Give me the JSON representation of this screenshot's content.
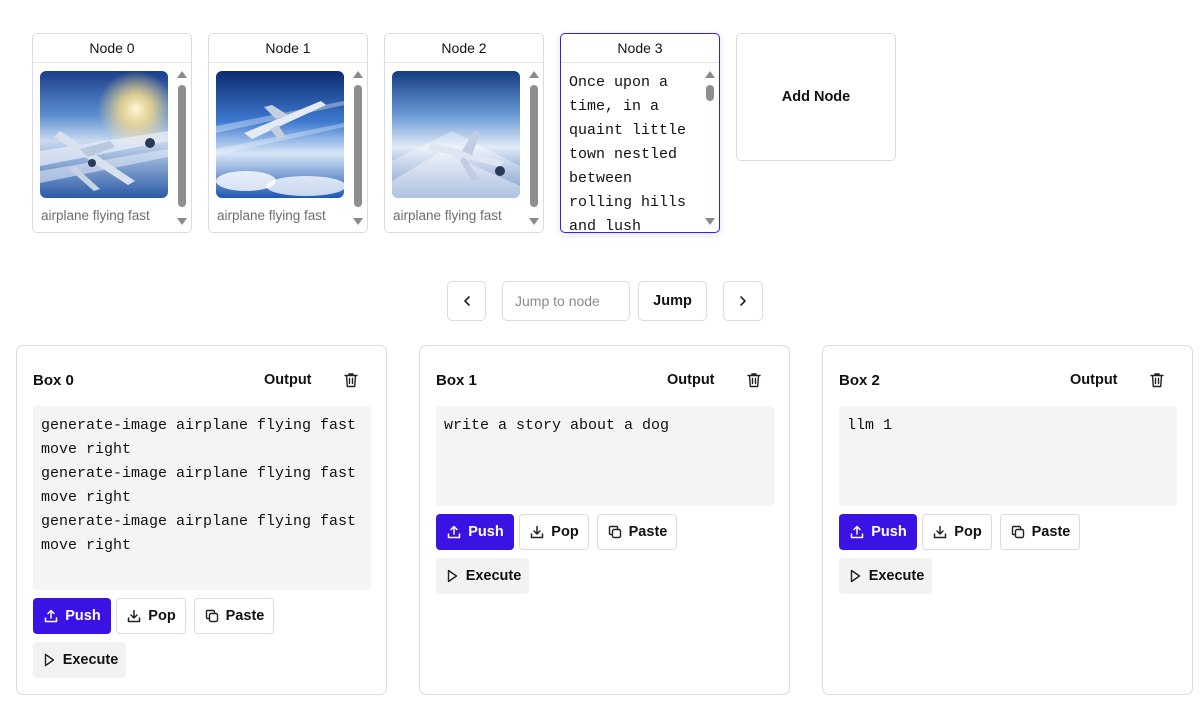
{
  "nodes": [
    {
      "title": "Node 0",
      "caption": "airplane flying fast"
    },
    {
      "title": "Node 1",
      "caption": "airplane flying fast"
    },
    {
      "title": "Node 2",
      "caption": "airplane flying fast"
    },
    {
      "title": "Node 3",
      "text": "Once upon a time, in a quaint little town nestled between rolling hills and lush"
    }
  ],
  "add_node_label": "Add Node",
  "navigation": {
    "jump_placeholder": "Jump to node",
    "jump_label": "Jump"
  },
  "boxes": [
    {
      "title": "Box 0",
      "output_label": "Output",
      "content": "generate-image airplane flying fast\nmove right\ngenerate-image airplane flying fast\nmove right\ngenerate-image airplane flying fast\nmove right",
      "push_label": "Push",
      "pop_label": "Pop",
      "paste_label": "Paste",
      "execute_label": "Execute"
    },
    {
      "title": "Box 1",
      "output_label": "Output",
      "content": "write a story about a dog",
      "push_label": "Push",
      "pop_label": "Pop",
      "paste_label": "Paste",
      "execute_label": "Execute"
    },
    {
      "title": "Box 2",
      "output_label": "Output",
      "content": "llm 1",
      "push_label": "Push",
      "pop_label": "Pop",
      "paste_label": "Paste",
      "execute_label": "Execute"
    }
  ],
  "colors": {
    "accent": "#3b12e4",
    "selected_border": "#3b1de0",
    "code_bg": "#f4f4f3",
    "execute_bg": "#f2f2f2"
  },
  "icons": [
    "chevron-left-icon",
    "chevron-right-icon",
    "trash-icon",
    "upload-icon",
    "download-icon",
    "copy-icon",
    "play-icon"
  ]
}
